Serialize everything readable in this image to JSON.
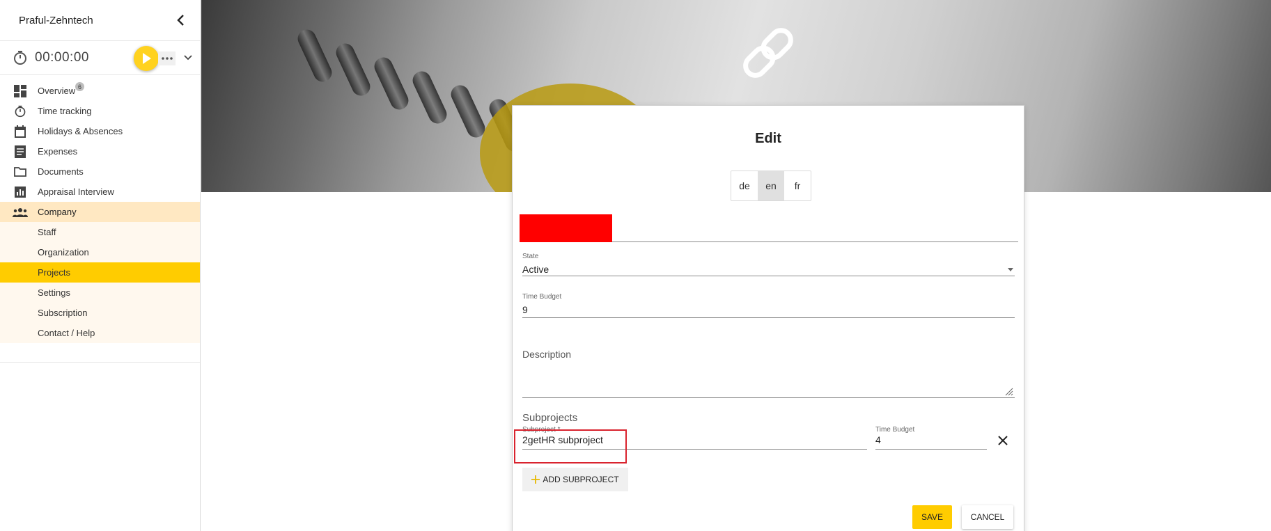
{
  "sidebar": {
    "title": "Praful-Zehntech",
    "timer": "00:00:00",
    "nav": [
      {
        "label": "Overview",
        "icon": "dashboard-icon",
        "badge": "6"
      },
      {
        "label": "Time tracking",
        "icon": "stopwatch-icon"
      },
      {
        "label": "Holidays & Absences",
        "icon": "calendar-icon"
      },
      {
        "label": "Expenses",
        "icon": "receipt-icon"
      },
      {
        "label": "Documents",
        "icon": "folder-icon"
      },
      {
        "label": "Appraisal Interview",
        "icon": "bar-chart-icon"
      },
      {
        "label": "Company",
        "icon": "people-icon"
      }
    ],
    "company_sub": [
      {
        "label": "Staff"
      },
      {
        "label": "Organization"
      },
      {
        "label": "Projects",
        "active": true
      },
      {
        "label": "Settings"
      },
      {
        "label": "Subscription"
      },
      {
        "label": "Contact / Help"
      }
    ]
  },
  "dialog": {
    "title": "Edit",
    "languages": [
      {
        "label": "de"
      },
      {
        "label": "en",
        "active": true
      },
      {
        "label": "fr"
      }
    ],
    "state": {
      "label": "State",
      "value": "Active"
    },
    "time_budget": {
      "label": "Time Budget",
      "value": "9"
    },
    "description": {
      "label": "Description",
      "value": ""
    },
    "subprojects": {
      "title": "Subprojects",
      "subproject_label": "Subproject *",
      "subproject_value": "2getHR subproject",
      "budget_label": "Time Budget",
      "budget_value": "4"
    },
    "add_subproject_label": "ADD SUBPROJECT",
    "save_label": "SAVE",
    "cancel_label": "CANCEL"
  },
  "colors": {
    "accent": "#ffcc00",
    "company_bg": "#ffe8c2",
    "sub_bg": "#fff8ee",
    "highlight": "#d9232e",
    "redaction": "#ff0000"
  }
}
